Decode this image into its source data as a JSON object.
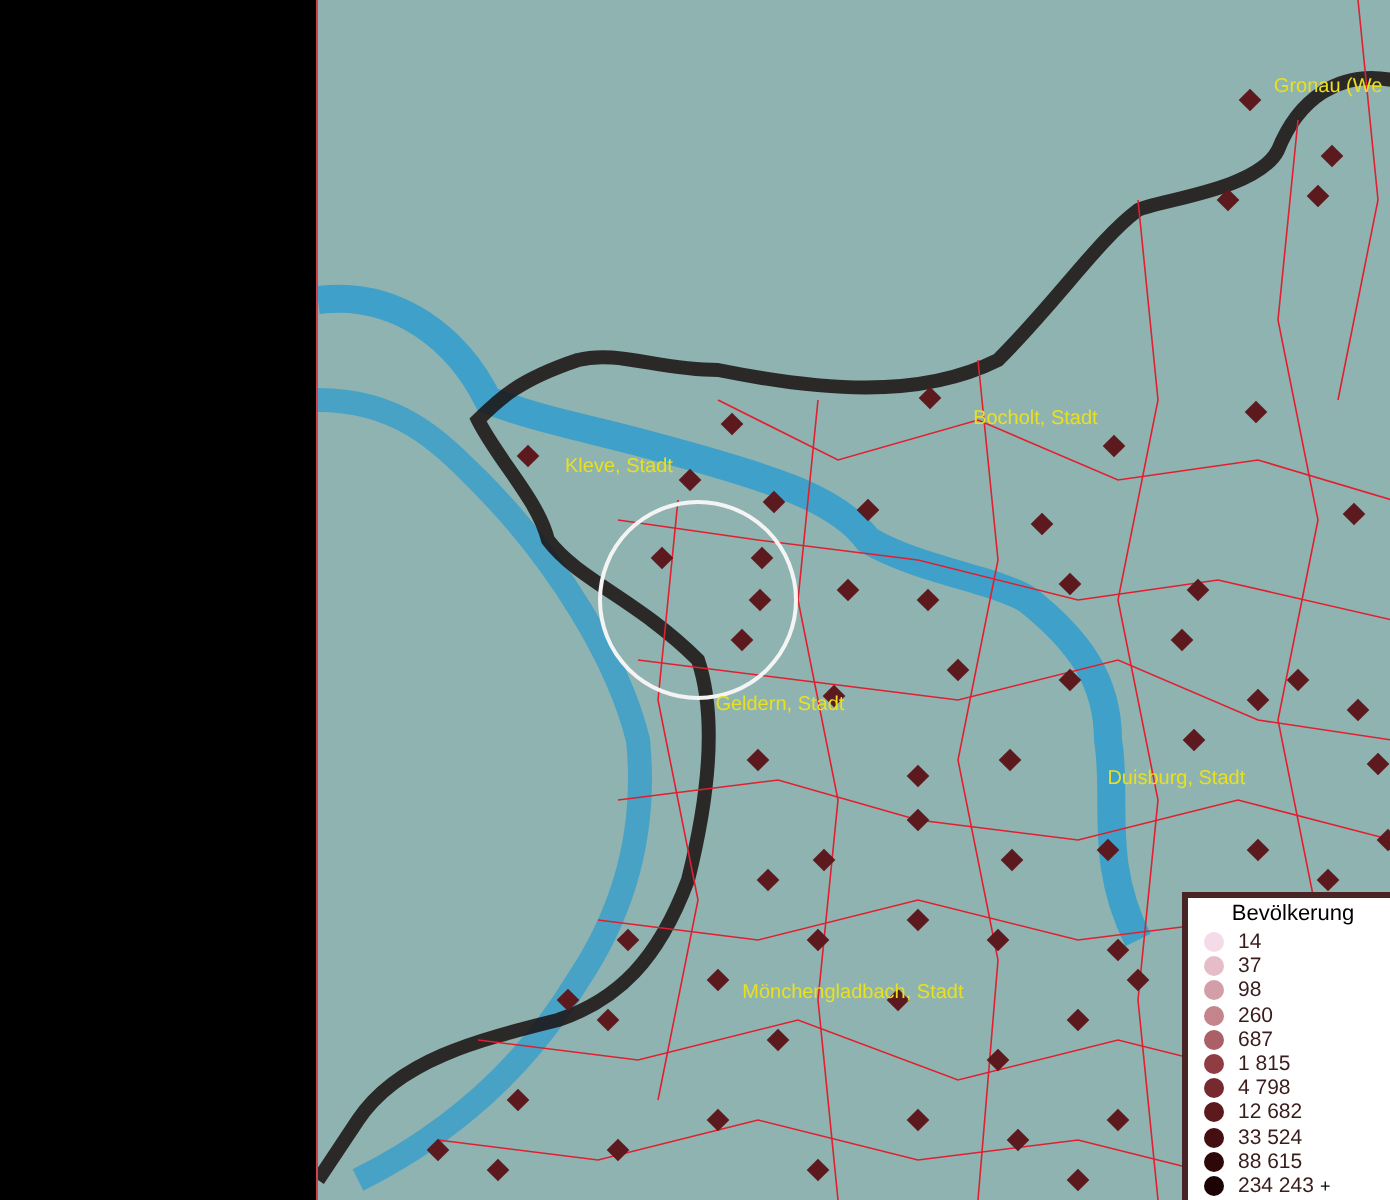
{
  "map": {
    "places": [
      {
        "name": "Gronau (We"
      },
      {
        "name": "Bocholt, Stadt"
      },
      {
        "name": "Kleve, Stadt"
      },
      {
        "name": "Geldern, Stadt"
      },
      {
        "name": "Duisburg, Stadt"
      },
      {
        "name": "Mönchengladbach, Stadt"
      }
    ]
  },
  "legend": {
    "title": "Bevölkerung",
    "overflow_mark": "+",
    "items": [
      {
        "label": "14",
        "color": "#f4dbe7"
      },
      {
        "label": "37",
        "color": "#e6bcc8"
      },
      {
        "label": "98",
        "color": "#d49ea8"
      },
      {
        "label": "260",
        "color": "#c3848c"
      },
      {
        "label": "687",
        "color": "#ab5f66"
      },
      {
        "label": "1 815",
        "color": "#8f3c43"
      },
      {
        "label": "4 798",
        "color": "#762a30"
      },
      {
        "label": "12 682",
        "color": "#5c1a1f"
      },
      {
        "label": "33 524",
        "color": "#440e12"
      },
      {
        "label": "88 615",
        "color": "#2e0709"
      },
      {
        "label": "234 243",
        "color": "#1c0405"
      }
    ]
  }
}
